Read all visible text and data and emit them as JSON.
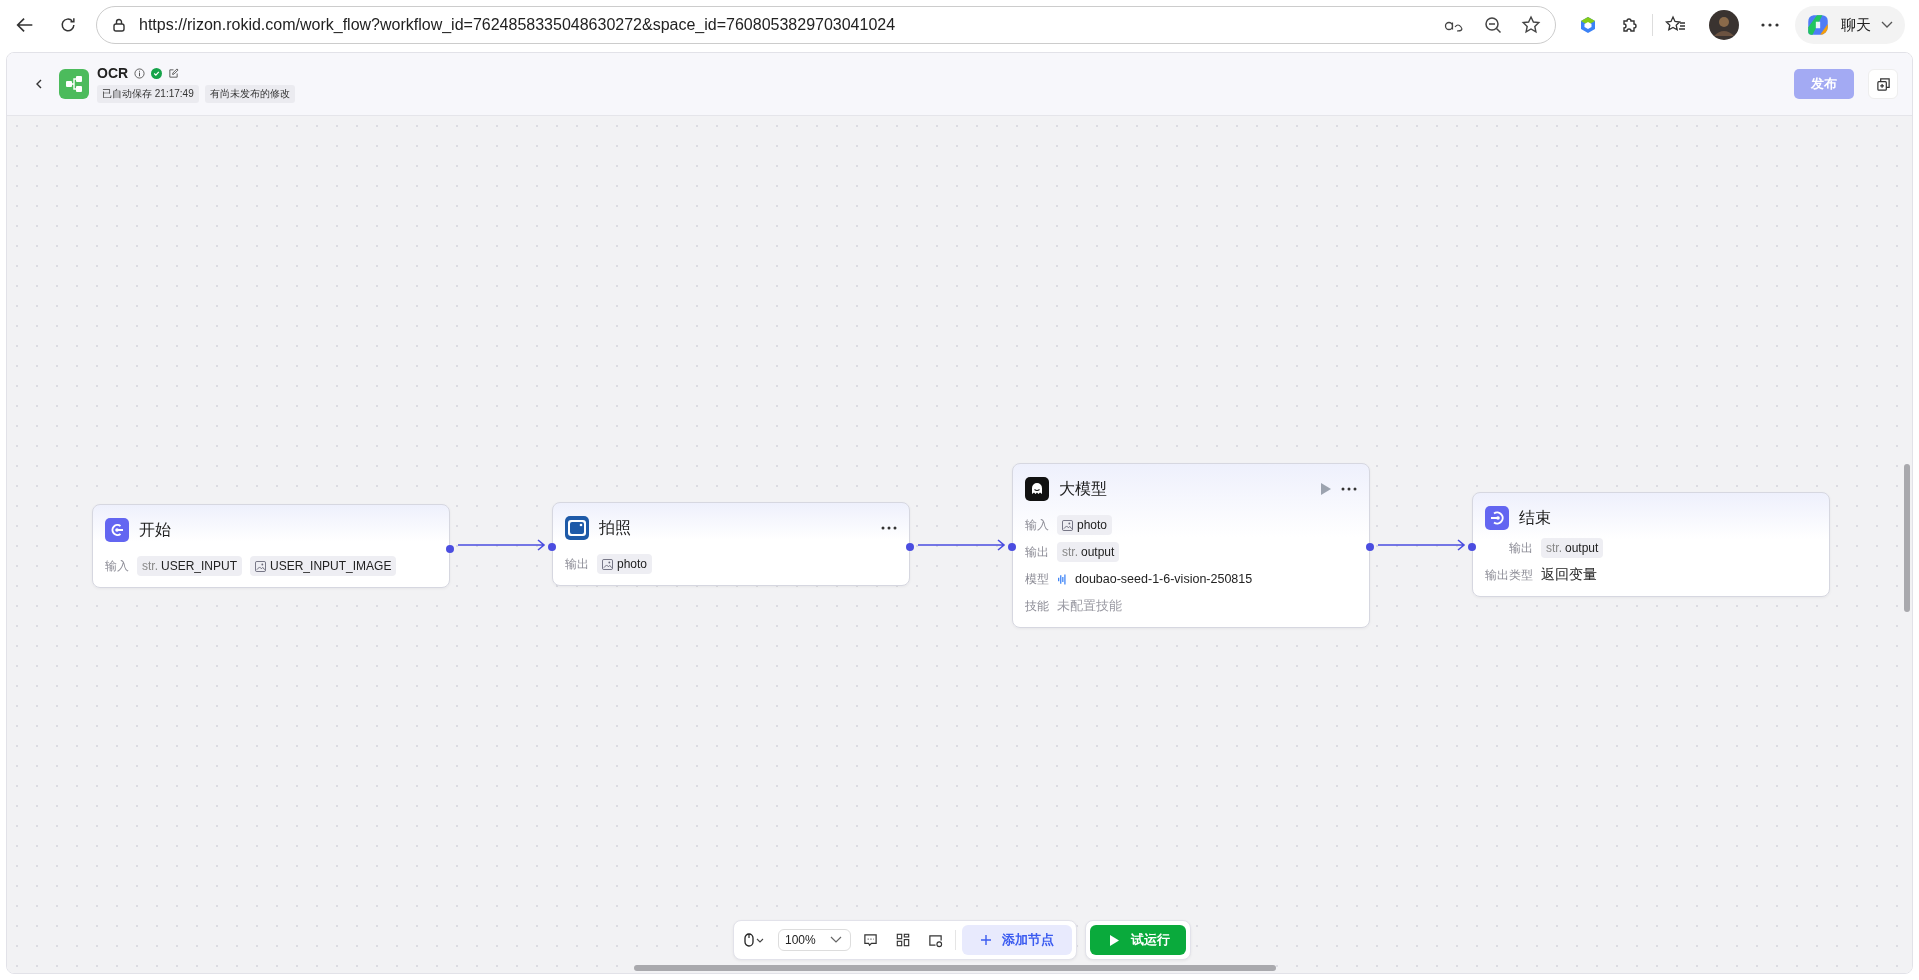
{
  "browser": {
    "url": "https://rizon.rokid.com/work_flow?workflow_id=7624858335048630272&space_id=7608053829703041024",
    "chat_label": "聊天"
  },
  "header": {
    "title": "OCR",
    "saved": "已自动保存 21:17:49",
    "status": "有尚未发布的修改",
    "publish": {
      "label": "发布",
      "disabled": true
    }
  },
  "nodes": [
    {
      "kind": "start",
      "title": "开始",
      "menu": false,
      "run": false,
      "fields": [
        {
          "kind": "vars",
          "label": "输入",
          "vars": [
            {
              "kind": "str",
              "prefix": "str.",
              "name": "USER_INPUT"
            },
            {
              "kind": "image",
              "name": "USER_INPUT_IMAGE"
            }
          ]
        }
      ]
    },
    {
      "kind": "camera",
      "title": "拍照",
      "menu": true,
      "run": false,
      "fields": [
        {
          "kind": "vars",
          "label": "输出",
          "vars": [
            {
              "kind": "image",
              "name": "photo"
            }
          ]
        }
      ]
    },
    {
      "kind": "llm",
      "title": "大模型",
      "menu": true,
      "run": true,
      "fields": [
        {
          "kind": "vars",
          "label": "输入",
          "vars": [
            {
              "kind": "image",
              "name": "photo"
            }
          ]
        },
        {
          "kind": "vars",
          "label": "输出",
          "vars": [
            {
              "kind": "str",
              "prefix": "str.",
              "name": "output"
            }
          ]
        },
        {
          "kind": "model",
          "label": "模型",
          "value": "doubao-seed-1-6-vision-250815"
        },
        {
          "kind": "text",
          "label": "技能",
          "value": "未配置技能",
          "muted": true
        }
      ]
    },
    {
      "kind": "end",
      "title": "结束",
      "menu": false,
      "run": false,
      "fields": [
        {
          "kind": "vars",
          "label": "输出",
          "vars": [
            {
              "kind": "str",
              "prefix": "str.",
              "name": "output"
            }
          ]
        },
        {
          "kind": "text",
          "label": "输出类型",
          "value": "返回变量",
          "muted": false
        }
      ]
    }
  ],
  "toolbar": {
    "zoom": "100%",
    "add_node": "添加节点",
    "test_run": "试运行"
  }
}
